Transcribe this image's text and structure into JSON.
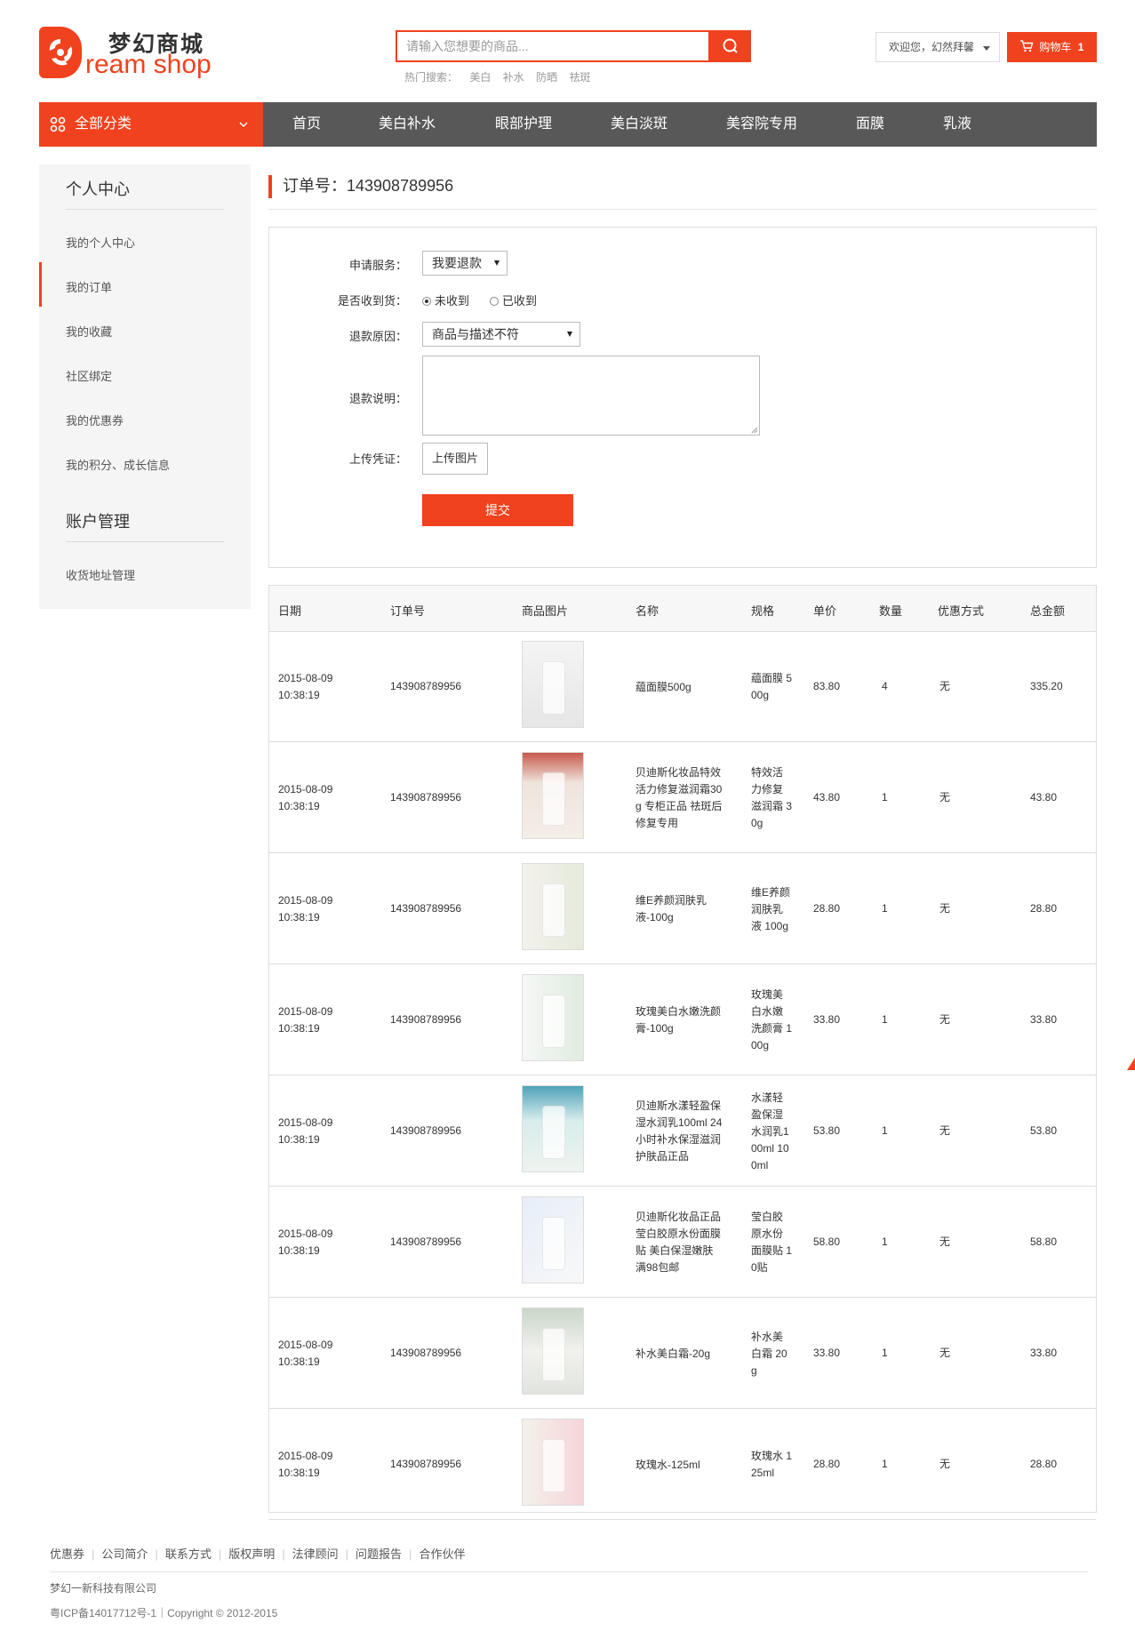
{
  "brand": {
    "name_cn": "梦幻商城",
    "name_en": "ream shop",
    "color": "#f0421e"
  },
  "search": {
    "placeholder": "请输入您想要的商品...",
    "hot_label": "热门搜索：",
    "hot_terms": [
      "美白",
      "补水",
      "防晒",
      "祛斑"
    ]
  },
  "header": {
    "welcome": "欢迎您，幻然拜馨",
    "cart_label": "购物车",
    "cart_count": "1"
  },
  "nav": {
    "all_categories": "全部分类",
    "items": [
      "首页",
      "美白补水",
      "眼部护理",
      "美白淡斑",
      "美容院专用",
      "面膜",
      "乳液"
    ]
  },
  "sidebar": {
    "section1_title": "个人中心",
    "section1_items": [
      "我的个人中心",
      "我的订单",
      "我的收藏",
      "社区绑定",
      "我的优惠券",
      "我的积分、成长信息"
    ],
    "active_index": 1,
    "section2_title": "账户管理",
    "section2_items": [
      "收货地址管理"
    ]
  },
  "order": {
    "title_label": "订单号：",
    "number": "143908789956"
  },
  "form": {
    "service_label": "申请服务：",
    "service_value": "我要退款",
    "received_label": "是否收到货：",
    "received_options": [
      "未收到",
      "已收到"
    ],
    "received_selected": 0,
    "reason_label": "退款原因：",
    "reason_value": "商品与描述不符",
    "desc_label": "退款说明：",
    "upload_label": "上传凭证：",
    "upload_button": "上传图片",
    "submit_button": "提交"
  },
  "table": {
    "headers": [
      "日期",
      "订单号",
      "商品图片",
      "名称",
      "规格",
      "单价",
      "数量",
      "优惠方式",
      "总金额"
    ],
    "rows": [
      {
        "date": "2015-08-09",
        "time": "10:38:19",
        "order": "143908789956",
        "name": [
          "藴面膜500g"
        ],
        "spec": [
          "藴面膜 5",
          "00g"
        ],
        "price": "83.80",
        "qty": "4",
        "discount": "无",
        "total": "335.20"
      },
      {
        "date": "2015-08-09",
        "time": "10:38:19",
        "order": "143908789956",
        "name": [
          "贝迪斯化妆品特效",
          "活力修复滋润霜30",
          "g 专柜正品 祛斑后",
          "修复专用"
        ],
        "spec": [
          "特效活",
          "力修复",
          "滋润霜 3",
          "0g"
        ],
        "price": "43.80",
        "qty": "1",
        "discount": "无",
        "total": "43.80"
      },
      {
        "date": "2015-08-09",
        "time": "10:38:19",
        "order": "143908789956",
        "name": [
          "维E养颜润肤乳",
          "液-100g"
        ],
        "spec": [
          "维E养颜",
          "润肤乳",
          "液 100g"
        ],
        "price": "28.80",
        "qty": "1",
        "discount": "无",
        "total": "28.80"
      },
      {
        "date": "2015-08-09",
        "time": "10:38:19",
        "order": "143908789956",
        "name": [
          "玫瑰美白水嫩洗颜",
          "膏-100g"
        ],
        "spec": [
          "玫瑰美",
          "白水嫩",
          "洗颜膏 1",
          "00g"
        ],
        "price": "33.80",
        "qty": "1",
        "discount": "无",
        "total": "33.80"
      },
      {
        "date": "2015-08-09",
        "time": "10:38:19",
        "order": "143908789956",
        "name": [
          "贝迪斯水漾轻盈保",
          "湿水润乳100ml 24",
          "小时补水保湿滋润",
          "护肤品正品"
        ],
        "spec": [
          "水漾轻",
          "盈保湿",
          "水润乳1",
          "00ml 10",
          "0ml"
        ],
        "price": "53.80",
        "qty": "1",
        "discount": "无",
        "total": "53.80"
      },
      {
        "date": "2015-08-09",
        "time": "10:38:19",
        "order": "143908789956",
        "name": [
          "贝迪斯化妆品正品",
          "莹白胶原水份面膜",
          "贴 美白保湿嫩肤",
          "满98包邮"
        ],
        "spec": [
          "莹白胶",
          "原水份",
          "面膜贴 1",
          "0贴"
        ],
        "price": "58.80",
        "qty": "1",
        "discount": "无",
        "total": "58.80"
      },
      {
        "date": "2015-08-09",
        "time": "10:38:19",
        "order": "143908789956",
        "name": [
          "补水美白霜-20g"
        ],
        "spec": [
          "补水美",
          "白霜 20",
          "g"
        ],
        "price": "33.80",
        "qty": "1",
        "discount": "无",
        "total": "33.80"
      },
      {
        "date": "2015-08-09",
        "time": "10:38:19",
        "order": "143908789956",
        "name": [
          "玫瑰水-125ml"
        ],
        "spec": [
          "玫瑰水 1",
          "25ml"
        ],
        "price": "28.80",
        "qty": "1",
        "discount": "无",
        "total": "28.80"
      }
    ]
  },
  "footer": {
    "links": [
      "优惠券",
      "公司简介",
      "联系方式",
      "版权声明",
      "法律顾问",
      "问题报告",
      "合作伙伴"
    ],
    "company": "梦幻一新科技有限公司",
    "copyright": "粤ICP备14017712号-1｜Copyright © 2012-2015"
  },
  "icons": {
    "search": "search-icon",
    "cart": "cart-icon",
    "categories": "grid-icon",
    "dropdown": "chevron-down-icon"
  }
}
